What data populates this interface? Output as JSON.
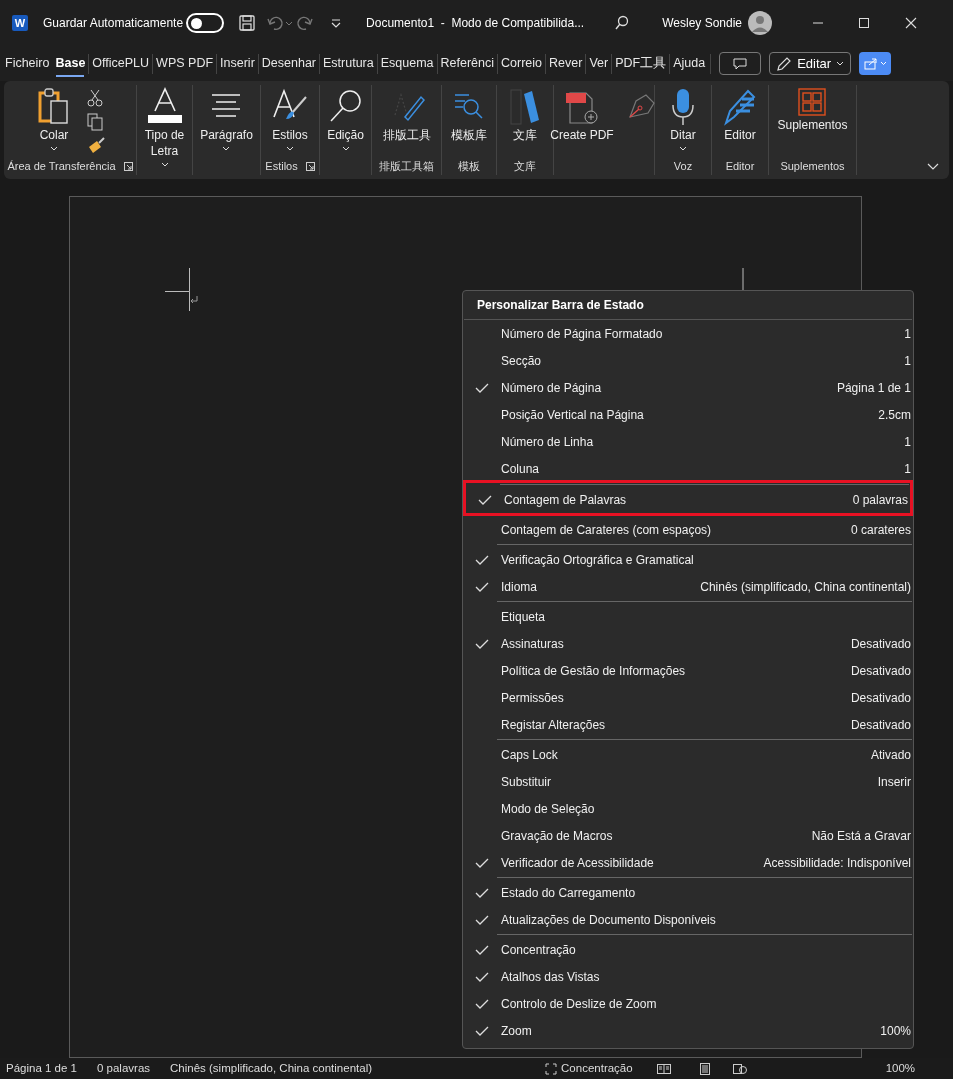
{
  "title_bar": {
    "app_badge": "W",
    "autosave": {
      "label": "Guardar Automaticamente",
      "on": false
    },
    "document_title": "Documento1  -  Modo de Compatibilida...",
    "user_name": "Wesley Sondie"
  },
  "tabs": [
    {
      "label": "Ficheiro",
      "selected": false
    },
    {
      "label": "Base",
      "selected": true
    },
    {
      "label": "OfficePLU",
      "selected": false
    },
    {
      "label": "WPS PDF",
      "selected": false
    },
    {
      "label": "Inserir",
      "selected": false
    },
    {
      "label": "Desenhar",
      "selected": false
    },
    {
      "label": "Estrutura",
      "selected": false
    },
    {
      "label": "Esquema",
      "selected": false
    },
    {
      "label": "Referênci",
      "selected": false
    },
    {
      "label": "Correio",
      "selected": false
    },
    {
      "label": "Rever",
      "selected": false
    },
    {
      "label": "Ver",
      "selected": false
    },
    {
      "label": "PDF工具",
      "selected": false
    },
    {
      "label": "Ajuda",
      "selected": false
    }
  ],
  "edit_button": "Editar",
  "ribbon_groups": [
    {
      "label": "Área de Transferência",
      "launcher": true,
      "buttons": [
        {
          "kind": "paste",
          "label": "Colar",
          "caret": true
        }
      ]
    },
    {
      "buttons": [
        {
          "kind": "font",
          "label": "Tipo de Letra",
          "caret": true
        }
      ]
    },
    {
      "buttons": [
        {
          "kind": "paragraph",
          "label": "Parágrafo",
          "caret": true
        }
      ]
    },
    {
      "label": "Estilos",
      "launcher": true,
      "buttons": [
        {
          "kind": "styles",
          "label": "Estilos",
          "caret": true
        }
      ]
    },
    {
      "buttons": [
        {
          "kind": "search",
          "label": "Edição",
          "caret": true
        }
      ]
    },
    {
      "label": "排版工具箱",
      "buttons": [
        {
          "kind": "pen",
          "label": "排版工具",
          "caret": false
        }
      ]
    },
    {
      "label": "模板",
      "buttons": [
        {
          "kind": "template",
          "label": "模板库",
          "caret": false
        }
      ]
    },
    {
      "label": "文库",
      "buttons": [
        {
          "kind": "library",
          "label": "文库",
          "caret": false
        }
      ]
    },
    {
      "buttons": [
        {
          "kind": "pdf",
          "label": "Create PDF",
          "caret": false
        },
        {
          "kind": "sign"
        }
      ]
    },
    {
      "label": "Voz",
      "buttons": [
        {
          "kind": "mic",
          "label": "Ditar",
          "caret": true
        }
      ]
    },
    {
      "label": "Editor",
      "buttons": [
        {
          "kind": "editor",
          "label": "Editor",
          "caret": false
        }
      ]
    },
    {
      "label": "Suplementos",
      "buttons": [
        {
          "kind": "addins",
          "label": "Suplementos",
          "caret": false
        }
      ]
    }
  ],
  "menu": {
    "title": "Personalizar Barra de Estado",
    "groups": [
      [
        {
          "label": "Número de Página Formatado",
          "value": "1",
          "checked": false,
          "highlighted": false
        },
        {
          "label": "Secção",
          "value": "1",
          "checked": false,
          "highlighted": false
        },
        {
          "label": "Número de Página",
          "value": "Página 1 de 1",
          "checked": true,
          "highlighted": false
        },
        {
          "label": "Posição Vertical na Página",
          "value": "2.5cm",
          "checked": false,
          "highlighted": false
        },
        {
          "label": "Número de Linha",
          "value": "1",
          "checked": false,
          "highlighted": false
        },
        {
          "label": "Coluna",
          "value": "1",
          "checked": false,
          "highlighted": false
        }
      ],
      [
        {
          "label": "Contagem de Palavras",
          "value": "0 palavras",
          "checked": true,
          "highlighted": true
        },
        {
          "label": "Contagem de Carateres (com espaços)",
          "value": "0 carateres",
          "checked": false,
          "highlighted": false
        }
      ],
      [
        {
          "label": "Verificação Ortográfica e Gramatical",
          "checked": true,
          "highlighted": false
        },
        {
          "label": "Idioma",
          "value": "Chinês (simplificado, China continental)",
          "checked": true,
          "highlighted": false
        }
      ],
      [
        {
          "label": "Etiqueta",
          "checked": false,
          "highlighted": false
        },
        {
          "label": "Assinaturas",
          "value": "Desativado",
          "checked": true,
          "highlighted": false
        },
        {
          "label": "Política de Gestão de Informações",
          "value": "Desativado",
          "checked": false,
          "highlighted": false
        },
        {
          "label": "Permissões",
          "value": "Desativado",
          "checked": false,
          "highlighted": false
        },
        {
          "label": "Registar Alterações",
          "value": "Desativado",
          "checked": false,
          "highlighted": false
        }
      ],
      [
        {
          "label": "Caps Lock",
          "value": "Ativado",
          "checked": false,
          "highlighted": false
        },
        {
          "label": "Substituir",
          "value": "Inserir",
          "checked": false,
          "highlighted": false
        },
        {
          "label": "Modo de Seleção",
          "checked": false,
          "highlighted": false
        },
        {
          "label": "Gravação de Macros",
          "value": "Não Está a Gravar",
          "checked": false,
          "highlighted": false
        },
        {
          "label": "Verificador de Acessibilidade",
          "value": "Acessibilidade: Indisponível",
          "checked": true,
          "highlighted": false
        }
      ],
      [
        {
          "label": "Estado do Carregamento",
          "checked": true,
          "highlighted": false
        },
        {
          "label": "Atualizações de Documento Disponíveis",
          "checked": true,
          "highlighted": false
        }
      ],
      [
        {
          "label": "Concentração",
          "checked": true,
          "highlighted": false
        },
        {
          "label": "Atalhos das Vistas",
          "checked": true,
          "highlighted": false
        },
        {
          "label": "Controlo de Deslize de Zoom",
          "checked": true,
          "highlighted": false
        },
        {
          "label": "Zoom",
          "value": "100%",
          "checked": true,
          "highlighted": false
        }
      ]
    ]
  },
  "status_bar": {
    "items": [
      "Página 1 de 1",
      "0 palavras",
      "Chinês (simplificado, China continental)"
    ],
    "focus": "Concentração",
    "zoom": "100%"
  }
}
